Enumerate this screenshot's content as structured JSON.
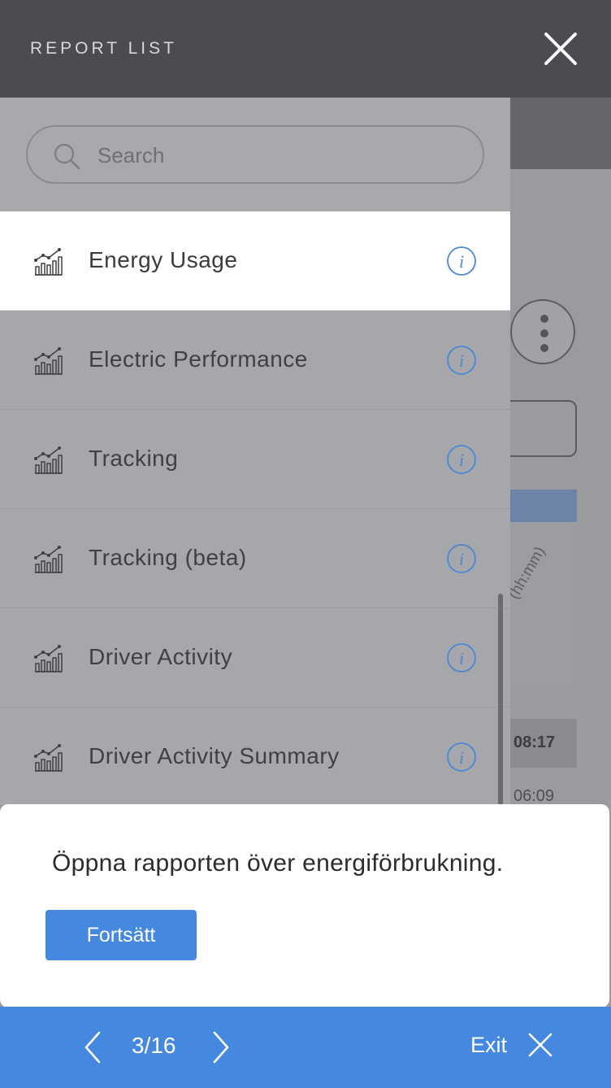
{
  "drawer": {
    "title": "REPORT LIST",
    "search": {
      "placeholder": "Search",
      "value": ""
    },
    "items": [
      {
        "label": "Energy Usage",
        "active": true
      },
      {
        "label": "Electric Performance",
        "active": false
      },
      {
        "label": "Tracking",
        "active": false
      },
      {
        "label": "Tracking (beta)",
        "active": false
      },
      {
        "label": "Driver Activity",
        "active": false
      },
      {
        "label": "Driver Activity Summary",
        "active": false
      }
    ]
  },
  "background": {
    "column_label": "(hh:mm)",
    "time_values": [
      "08:17",
      "06:09"
    ]
  },
  "tour": {
    "message": "Öppna rapporten över energiförbrukning.",
    "continue_label": "Fortsätt",
    "step": "3/16",
    "exit_label": "Exit"
  },
  "colors": {
    "accent": "#4588df",
    "header": "#4b4c51",
    "info_icon": "#4a86d8"
  },
  "icons": {
    "item_icon": "chart-icon",
    "info": "info-icon",
    "close": "close-icon",
    "search": "search-icon"
  }
}
